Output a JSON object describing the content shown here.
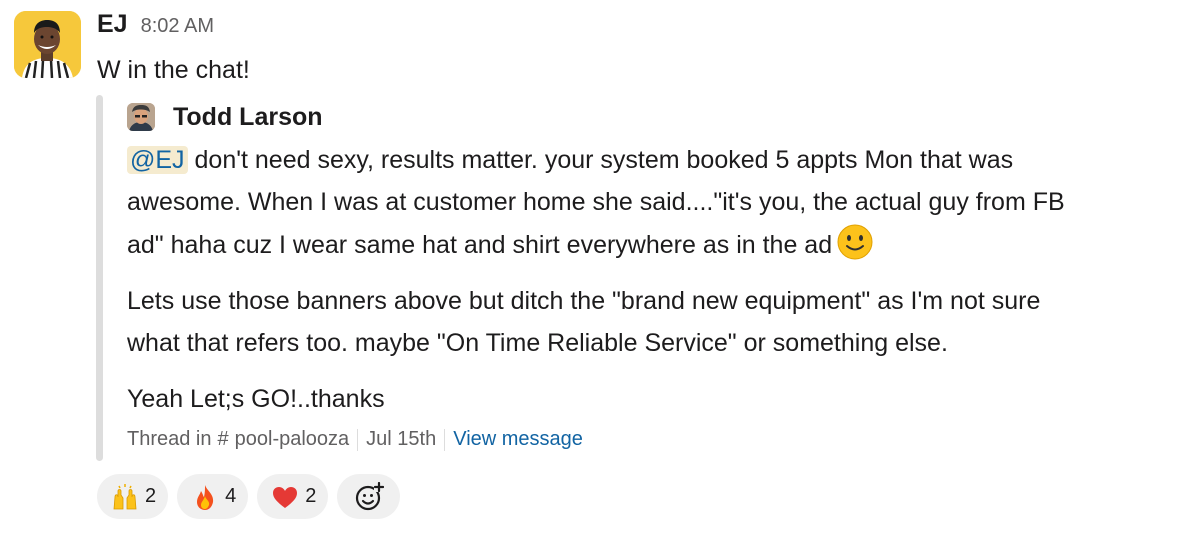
{
  "message": {
    "author": "EJ",
    "time": "8:02 AM",
    "text": "W in the chat!"
  },
  "quoted": {
    "author": "Todd Larson",
    "mention": "@EJ",
    "para1_line1_rest": " don't need sexy, results matter. your system booked 5 appts Mon that was",
    "para1_line2": "awesome. When I was at customer home she said....\"it's you, the actual guy from FB",
    "para1_line3": "ad\" haha cuz I wear same hat and shirt everywhere as in the ad",
    "para1_emoji": "slightly-smiling-face-icon",
    "para2_line1": "Lets use those banners above but ditch the \"brand new equipment\" as I'm not sure",
    "para2_line2": "what that refers too. maybe \"On Time Reliable Service\" or something else.",
    "para3": "Yeah Let;s GO!..thanks"
  },
  "footer": {
    "thread_in": "Thread in",
    "hash": "#",
    "channel": "pool-palooza",
    "date": "Jul 15th",
    "view_link": "View message"
  },
  "reactions": [
    {
      "emoji": "raised-hands-icon",
      "count": "2"
    },
    {
      "emoji": "fire-icon",
      "count": "4"
    },
    {
      "emoji": "red-heart-icon",
      "count": "2"
    }
  ],
  "add_reaction": {
    "icon": "add-reaction-icon"
  },
  "colors": {
    "avatar_bg": "#f6c83b",
    "link": "#1264a3",
    "mention_bg": "#f5ebcf",
    "muted": "#616061",
    "quote_bar": "#dddddd",
    "reaction_bg": "#f0f0f0"
  }
}
